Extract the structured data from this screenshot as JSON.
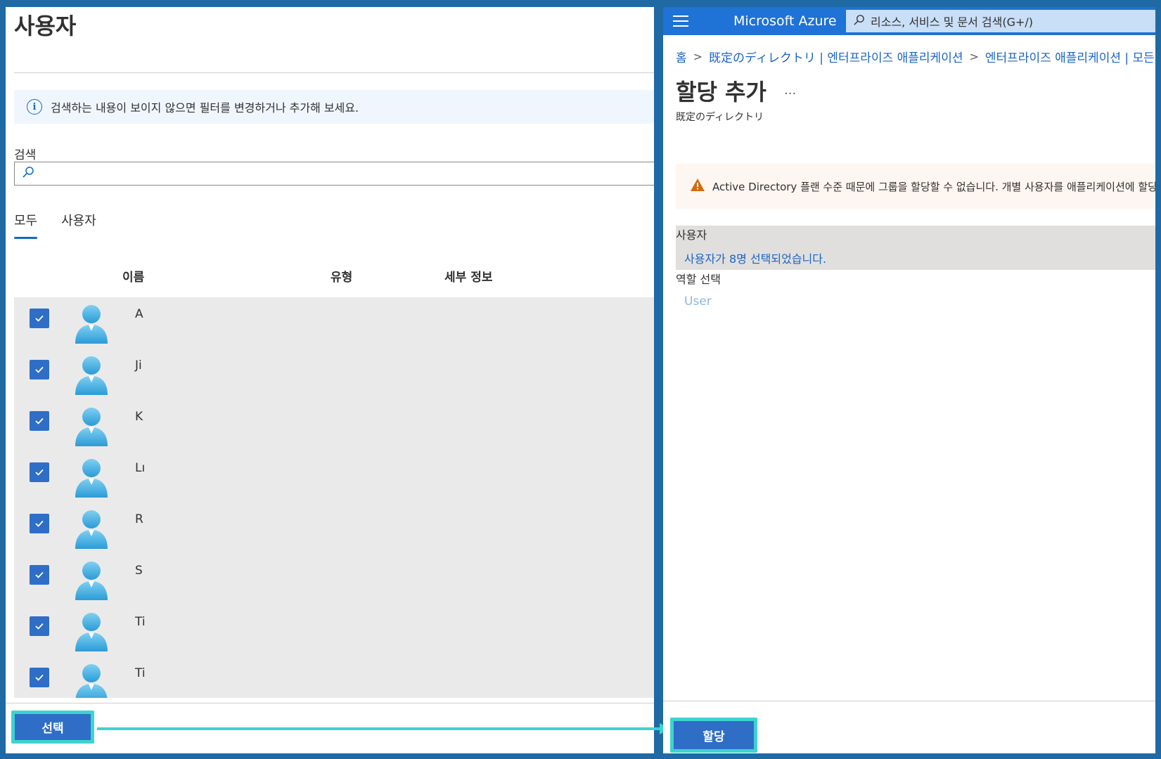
{
  "left": {
    "title": "사용자",
    "info_text": "검색하는 내용이 보이지 않으면 필터를 변경하거나 추가해 보세요.",
    "search_label": "검색",
    "search_value": "",
    "search_placeholder": "",
    "tabs": [
      {
        "label": "모두",
        "active": true
      },
      {
        "label": "사용자",
        "active": false
      }
    ],
    "columns": [
      "이름",
      "유형",
      "세부 정보"
    ],
    "rows": [
      {
        "name": "A",
        "checked": true
      },
      {
        "name": "Ji",
        "checked": true
      },
      {
        "name": "K",
        "checked": true
      },
      {
        "name": "Lı",
        "checked": true
      },
      {
        "name": "R",
        "checked": true
      },
      {
        "name": "S",
        "checked": true
      },
      {
        "name": "Ti",
        "checked": true
      },
      {
        "name": "Ti",
        "checked": true
      }
    ],
    "select_button": "선택"
  },
  "right": {
    "brand": "Microsoft Azure",
    "global_search": "리소스, 서비스 및 문서 검색(G+/)",
    "breadcrumb": [
      "홈",
      "既定のディレクトリ | 엔터프라이즈 애플리케이션",
      "엔터프라이즈 애플리케이션 | 모든"
    ],
    "title": "할당 추가",
    "more": "...",
    "subtitle": "既定のディレクトリ",
    "warning": "Active Directory 플랜 수준 때문에 그룹을 할당할 수 없습니다. 개별 사용자를 애플리케이션에 할당",
    "users_label": "사용자",
    "users_value": "사용자가 8명 선택되었습니다.",
    "role_label": "역할 선택",
    "role_value": "User",
    "assign_button": "할당"
  },
  "colors": {
    "primary": "#2f6ec7",
    "link": "#1a64c4",
    "highlight": "#3ed3d0",
    "azure_bar": "#1f72d6",
    "frame": "#1f6aa5"
  }
}
